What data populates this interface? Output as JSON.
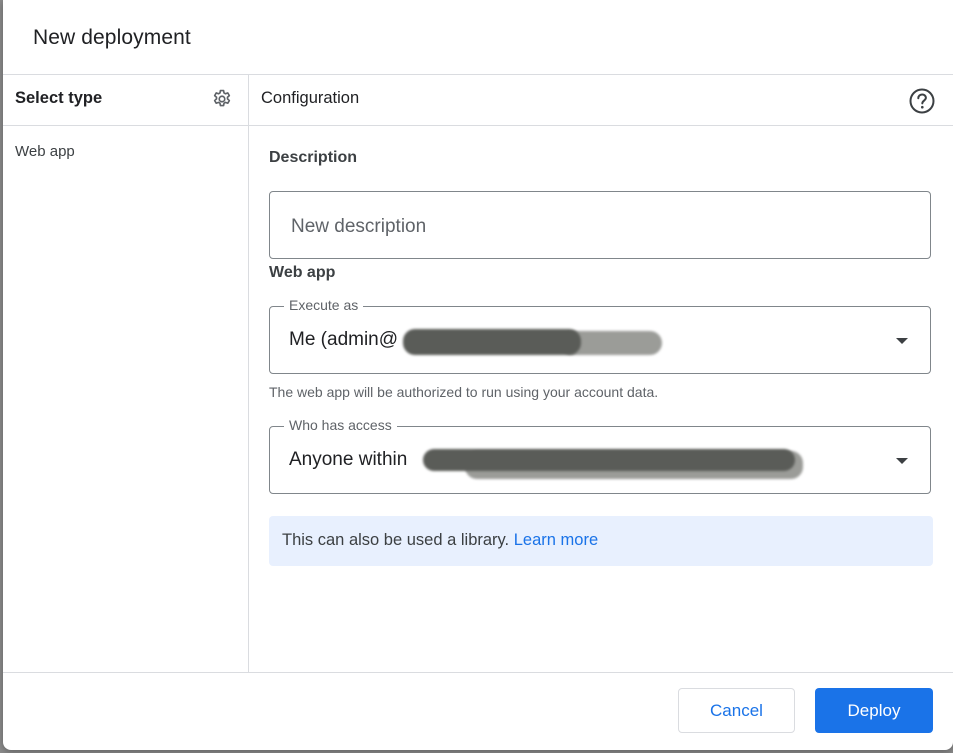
{
  "dialog": {
    "title": "New deployment"
  },
  "left_panel": {
    "header": "Select type",
    "settings_icon": "gear-icon",
    "types": [
      "Web app"
    ]
  },
  "right_panel": {
    "header": "Configuration",
    "help_icon": "help-circle-icon",
    "description_section": "Description",
    "description_placeholder": "New description",
    "description_value": "",
    "webapp_section": "Web app",
    "execute_as": {
      "legend": "Execute as",
      "value": "Me (admin@"
    },
    "execute_helper": "The web app will be authorized to run using your account data.",
    "who_has_access": {
      "legend": "Who has access",
      "value": "Anyone within"
    },
    "info": {
      "text": "This can also be used a library.",
      "link": "Learn more"
    }
  },
  "footer": {
    "cancel_label": "Cancel",
    "deploy_label": "Deploy"
  },
  "colors": {
    "accent": "#1a73e8",
    "info_bg": "#e8f0fe",
    "divider": "#dadce0"
  }
}
